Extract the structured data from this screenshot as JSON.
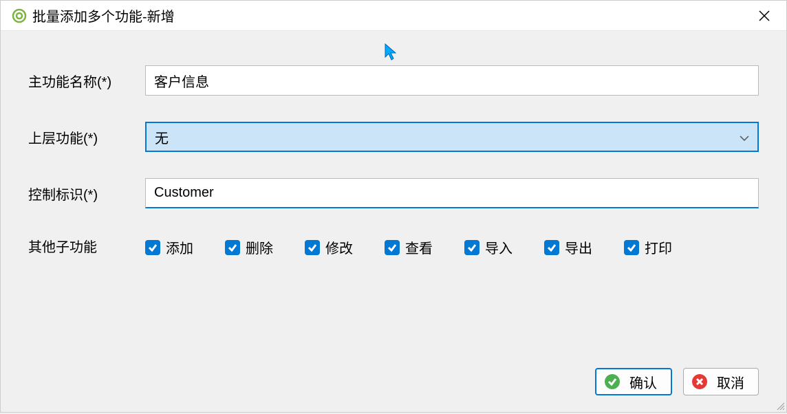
{
  "window": {
    "title": "批量添加多个功能-新增"
  },
  "form": {
    "main_name_label": "主功能名称(*)",
    "main_name_value": "客户信息",
    "parent_label": "上层功能(*)",
    "parent_value": "无",
    "control_id_label": "控制标识(*)",
    "control_id_value": "Customer",
    "sub_label": "其他子功能",
    "subs": [
      {
        "label": "添加",
        "checked": true
      },
      {
        "label": "删除",
        "checked": true
      },
      {
        "label": "修改",
        "checked": true
      },
      {
        "label": "查看",
        "checked": true
      },
      {
        "label": "导入",
        "checked": true
      },
      {
        "label": "导出",
        "checked": true
      },
      {
        "label": "打印",
        "checked": true
      }
    ]
  },
  "buttons": {
    "ok": "确认",
    "cancel": "取消"
  }
}
